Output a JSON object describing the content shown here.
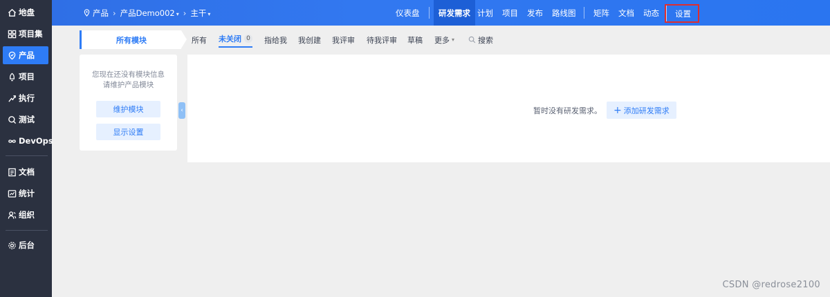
{
  "sidebar": {
    "items": [
      {
        "label": "地盘",
        "icon": "home-icon"
      },
      {
        "label": "项目集",
        "icon": "grid-icon"
      },
      {
        "label": "产品",
        "icon": "product-icon"
      },
      {
        "label": "项目",
        "icon": "project-icon"
      },
      {
        "label": "执行",
        "icon": "run-icon"
      },
      {
        "label": "测试",
        "icon": "test-icon"
      },
      {
        "label": "DevOps",
        "icon": "infinity-icon"
      },
      {
        "label": "文档",
        "icon": "doc-icon"
      },
      {
        "label": "统计",
        "icon": "chart-icon"
      },
      {
        "label": "组织",
        "icon": "org-icon"
      },
      {
        "label": "后台",
        "icon": "gear-icon"
      }
    ],
    "active": "产品"
  },
  "header": {
    "breadcrumb": {
      "root": "产品",
      "product": "产品Demo002",
      "branch": "主干"
    },
    "nav": [
      "仪表盘",
      "研发需求",
      "计划",
      "项目",
      "发布",
      "路线图",
      "矩阵",
      "文档",
      "动态",
      "设置"
    ],
    "active_nav": "研发需求",
    "highlighted_nav": "设置"
  },
  "subnav": {
    "module_tab": "所有模块",
    "filters": [
      "所有",
      "未关闭",
      "指给我",
      "我创建",
      "我评审",
      "待我评审",
      "草稿",
      "更多",
      "搜索"
    ],
    "active_filter": "未关闭",
    "unclosed_count": "0"
  },
  "left_panel": {
    "empty_line1": "您现在还没有模块信息",
    "empty_line2": "请维护产品模块",
    "maintain_button": "维护模块",
    "display_button": "显示设置"
  },
  "main": {
    "empty_text": "暂时没有研发需求。",
    "add_button": "添加研发需求"
  },
  "watermark": "CSDN @redrose2100",
  "colors": {
    "accent": "#2e7cf6",
    "sidebar": "#2b3140",
    "highlight_box": "#e02d2d"
  }
}
